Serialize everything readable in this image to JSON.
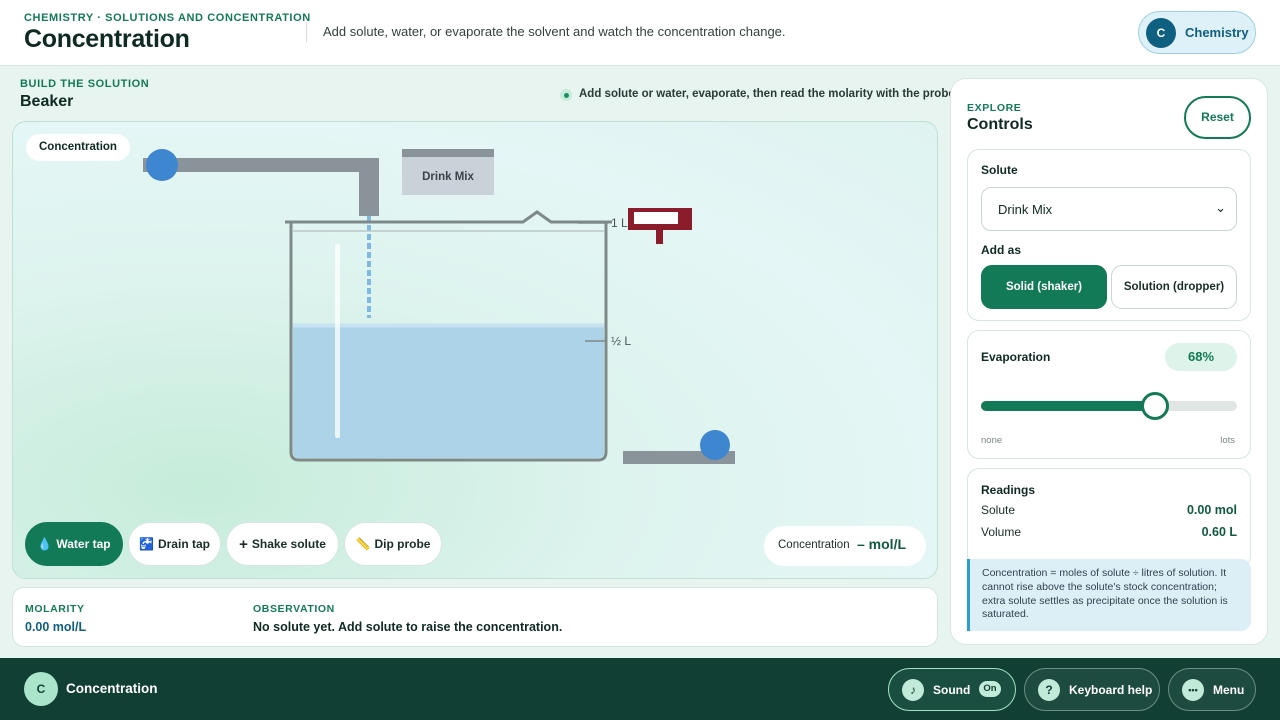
{
  "header": {
    "kicker": "CHEMISTRY · SOLUTIONS AND CONCENTRATION",
    "title": "Concentration",
    "subtitle": "Add solute, water, or evaporate the solvent and watch the concentration change.",
    "badge_initial": "C",
    "badge_label": "Chemistry"
  },
  "workspace": {
    "kicker": "BUILD THE SOLUTION",
    "title": "Beaker",
    "hint": "Add solute or water, evaporate, then read the molarity with the probe.",
    "stage_label": "Concentration",
    "shaker_label": "Drink Mix",
    "marks": {
      "full": "1 L",
      "half": "½ L"
    },
    "tools": [
      {
        "icon": "💧",
        "label": "Water tap",
        "active": true
      },
      {
        "icon": "🚰",
        "label": "Drain tap",
        "active": false
      },
      {
        "icon": "+",
        "label": "Shake solute",
        "active": false
      },
      {
        "icon": "📏",
        "label": "Dip probe",
        "active": false
      }
    ],
    "readout_label": "Concentration",
    "readout_value": "– mol/L",
    "solution_fill_fraction": 0.6,
    "colors": {
      "accent": "#127a56",
      "water": "#acd3e8",
      "probe": "#8b1c2c",
      "pipe": "#8a939a"
    }
  },
  "info": {
    "molarity_label": "MOLARITY",
    "molarity_value": "0.00 mol/L",
    "observation_label": "OBSERVATION",
    "observation_value": "No solute yet. Add solute to raise the concentration."
  },
  "panel": {
    "kicker": "EXPLORE",
    "title": "Controls",
    "reset_label": "Reset",
    "solute_label": "Solute",
    "solute_value": "Drink Mix",
    "add_as_label": "Add as",
    "add_as_options": [
      "Solid (shaker)",
      "Solution (dropper)"
    ],
    "evaporation_label": "Evaporation",
    "evaporation_value": "68%",
    "evaporation_fraction": 0.68,
    "slider_min": "none",
    "slider_max": "lots",
    "readings_label": "Readings",
    "readings": [
      {
        "label": "Solute",
        "value": "0.00 mol"
      },
      {
        "label": "Volume",
        "value": "0.60 L"
      }
    ],
    "note": "Concentration = moles of solute ÷ litres of solution. It cannot rise above the solute's stock concentration; extra solute settles as precipitate once the solution is saturated."
  },
  "footer": {
    "logo_initial": "C",
    "title": "Concentration",
    "sound_label": "Sound",
    "sound_state": "On",
    "keyboard_icon": "?",
    "keyboard_label": "Keyboard help",
    "menu_icon": "•••",
    "menu_label": "Menu"
  }
}
